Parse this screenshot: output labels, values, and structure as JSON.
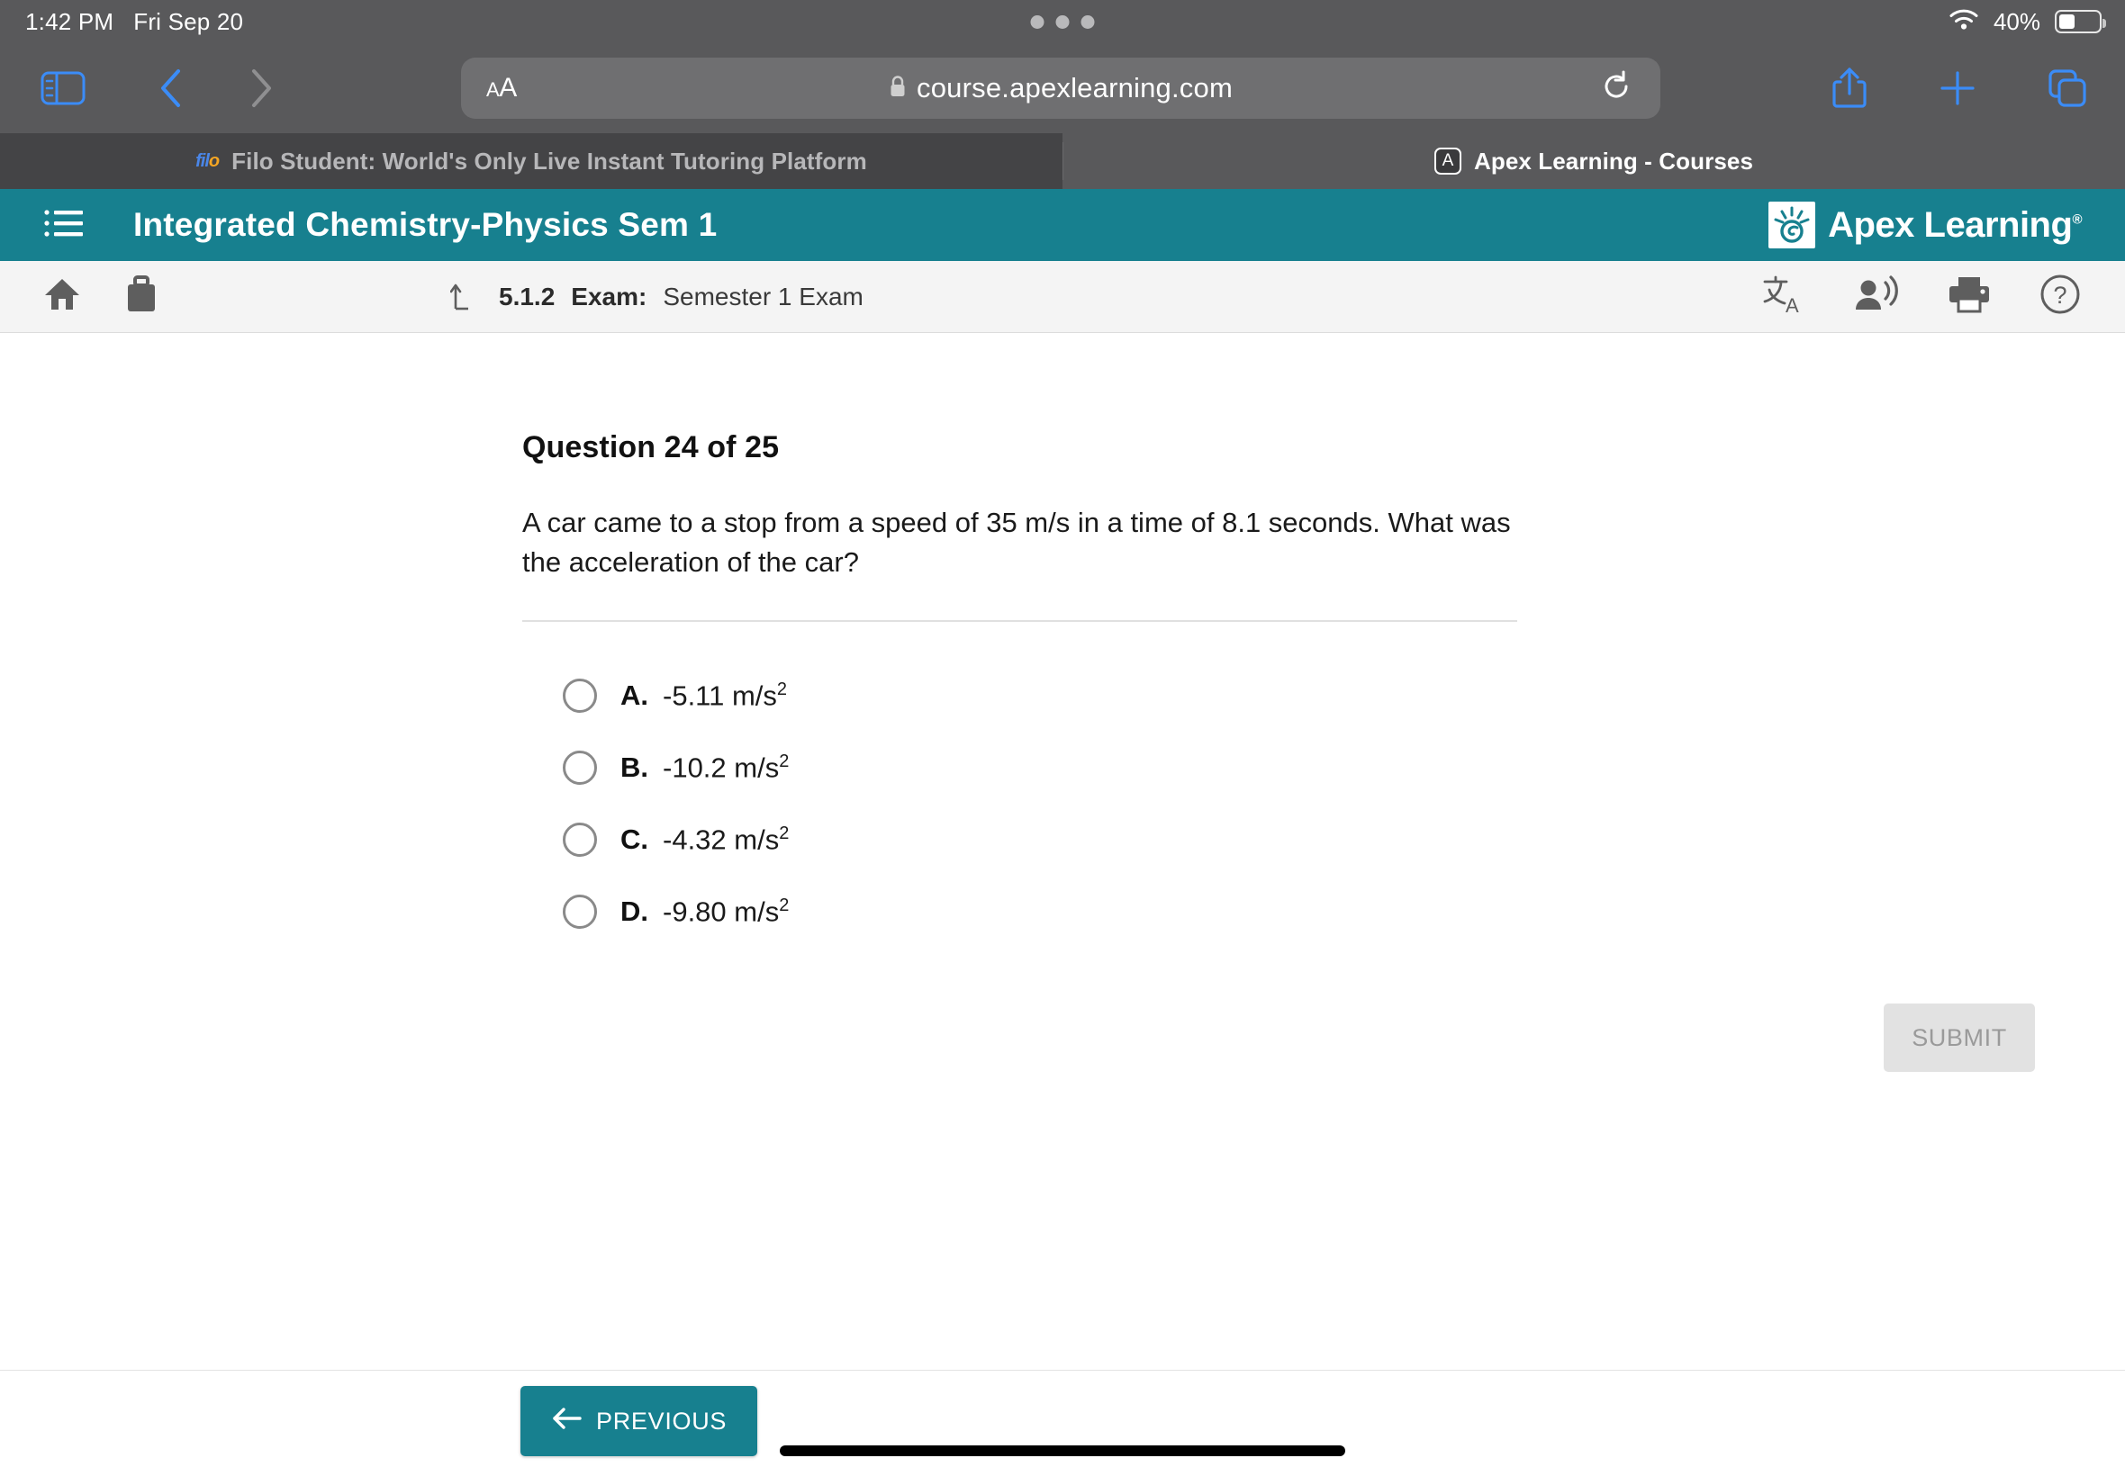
{
  "status_bar": {
    "time": "1:42 PM",
    "date": "Fri Sep 20",
    "battery_percent": "40%",
    "wifi_icon": "wifi-icon",
    "battery_icon": "battery-icon"
  },
  "browser": {
    "sidebar_icon": "sidebar-toggle-icon",
    "back_icon": "back-chevron-icon",
    "forward_icon": "forward-chevron-icon",
    "text_size_label": "AA",
    "lock_icon": "lock-icon",
    "url": "course.apexlearning.com",
    "reload_icon": "reload-icon",
    "share_icon": "share-icon",
    "new_tab_icon": "plus-icon",
    "tabs_overview_icon": "tabs-overview-icon",
    "tabs": [
      {
        "title": "Filo Student: World's Only Live Instant Tutoring Platform",
        "favicon": "filo-favicon",
        "active": false,
        "close_label": "×"
      },
      {
        "title": "Apex Learning - Courses",
        "favicon": "apex-favicon",
        "favicon_letter": "A",
        "active": true
      }
    ]
  },
  "course_header": {
    "menu_icon": "hamburger-menu-icon",
    "title": "Integrated Chemistry-Physics Sem 1",
    "logo_text": "Apex Learning",
    "logo_trademark": "®",
    "background_color": "#17808f"
  },
  "sub_toolbar": {
    "home_icon": "home-icon",
    "briefcase_icon": "briefcase-icon",
    "up_arrow_icon": "up-arrow-icon",
    "lesson_number": "5.1.2",
    "lesson_kind": "Exam:",
    "lesson_name": "Semester 1 Exam",
    "translate_icon": "translate-icon",
    "read_aloud_icon": "read-aloud-icon",
    "print_icon": "print-icon",
    "help_icon": "help-icon"
  },
  "question": {
    "heading": "Question 24 of 25",
    "number": 24,
    "total": 25,
    "text": "A car came to a stop from a speed of 35 m/s in a time of 8.1 seconds. What was the acceleration of the car?",
    "options": [
      {
        "letter": "A.",
        "value": "-5.11 m/s",
        "exponent": "2",
        "selected": false
      },
      {
        "letter": "B.",
        "value": "-10.2 m/s",
        "exponent": "2",
        "selected": false
      },
      {
        "letter": "C.",
        "value": "-4.32 m/s",
        "exponent": "2",
        "selected": false
      },
      {
        "letter": "D.",
        "value": "-9.80 m/s",
        "exponent": "2",
        "selected": false
      }
    ],
    "submit_label": "SUBMIT",
    "submit_enabled": false
  },
  "bottom_nav": {
    "previous_label": "PREVIOUS",
    "previous_arrow_icon": "arrow-left-icon"
  }
}
